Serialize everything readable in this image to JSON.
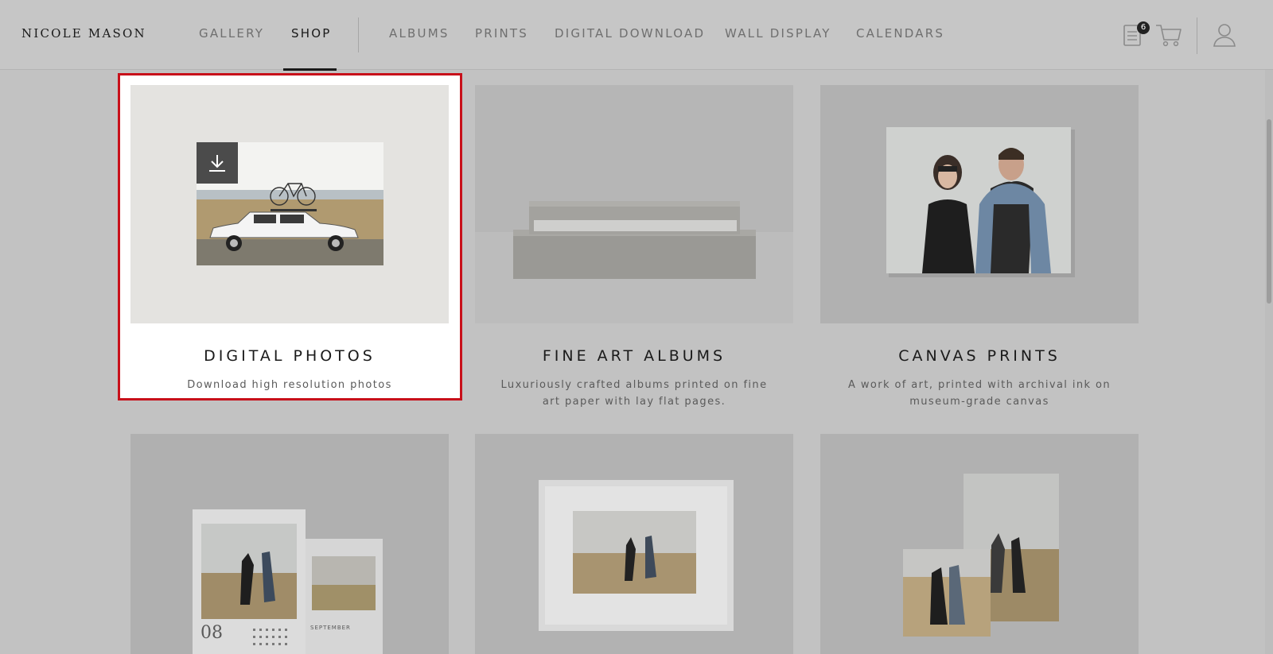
{
  "header": {
    "logo": "NICOLE MASON",
    "nav_primary": [
      {
        "label": "GALLERY",
        "active": false
      },
      {
        "label": "SHOP",
        "active": true
      }
    ],
    "nav_secondary": [
      {
        "label": "ALBUMS"
      },
      {
        "label": "PRINTS"
      },
      {
        "label": "DIGITAL DOWNLOAD"
      },
      {
        "label": "WALL DISPLAY"
      },
      {
        "label": "CALENDARS"
      }
    ],
    "orders_badge": "6",
    "icons": [
      "orders-icon",
      "cart-icon",
      "account-icon"
    ]
  },
  "products": [
    {
      "title": "DIGITAL PHOTOS",
      "description": "Download high resolution photos",
      "icon": "download-icon"
    },
    {
      "title": "FINE ART ALBUMS",
      "description": "Luxuriously crafted albums printed on fine art paper with lay flat pages."
    },
    {
      "title": "CANVAS PRINTS",
      "description": "A work of art, printed with archival ink on museum-grade canvas"
    },
    {
      "title": "",
      "description": "",
      "calendar_month_num": "08",
      "calendar_month_name": "SEPTEMBER"
    },
    {
      "title": "",
      "description": ""
    },
    {
      "title": "",
      "description": ""
    }
  ],
  "colors": {
    "overlay_bg": "#c2c2c2",
    "highlight_border": "#c8101a",
    "text_dark": "#1a1a1a"
  }
}
